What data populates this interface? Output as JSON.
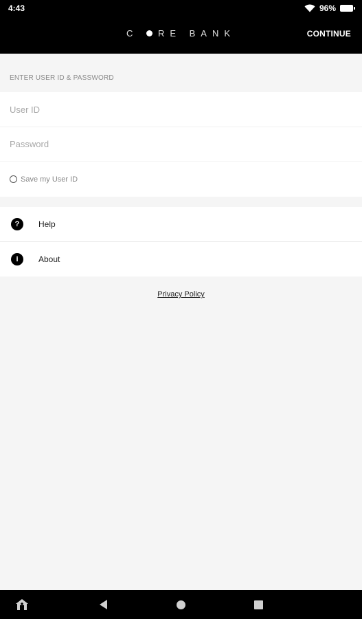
{
  "status_bar": {
    "time": "4:43",
    "battery": "96%",
    "wifi_icon": "wifi-icon",
    "battery_icon": "battery-icon"
  },
  "app_bar": {
    "brand": "C RE BANK",
    "brand_prefix": "C",
    "brand_suffix": "RE BANK",
    "continue_label": "CONTINUE"
  },
  "login": {
    "section_header": "ENTER USER ID & PASSWORD",
    "user_id_placeholder": "User ID",
    "user_id_value": "",
    "password_placeholder": "Password",
    "password_value": "",
    "save_user_id_label": "Save my User ID",
    "save_user_id_checked": false
  },
  "menu": {
    "items": [
      {
        "label": "Help",
        "icon": "help-icon",
        "glyph": "?"
      },
      {
        "label": "About",
        "icon": "info-icon",
        "glyph": "i"
      }
    ]
  },
  "footer": {
    "privacy_link": "Privacy Policy"
  },
  "nav_bar": {
    "icons": [
      "home-app-icon",
      "back-icon",
      "home-icon",
      "recents-icon"
    ]
  },
  "colors": {
    "app_bar_bg": "#000000",
    "page_bg": "#f5f5f5",
    "card_bg": "#ffffff"
  }
}
